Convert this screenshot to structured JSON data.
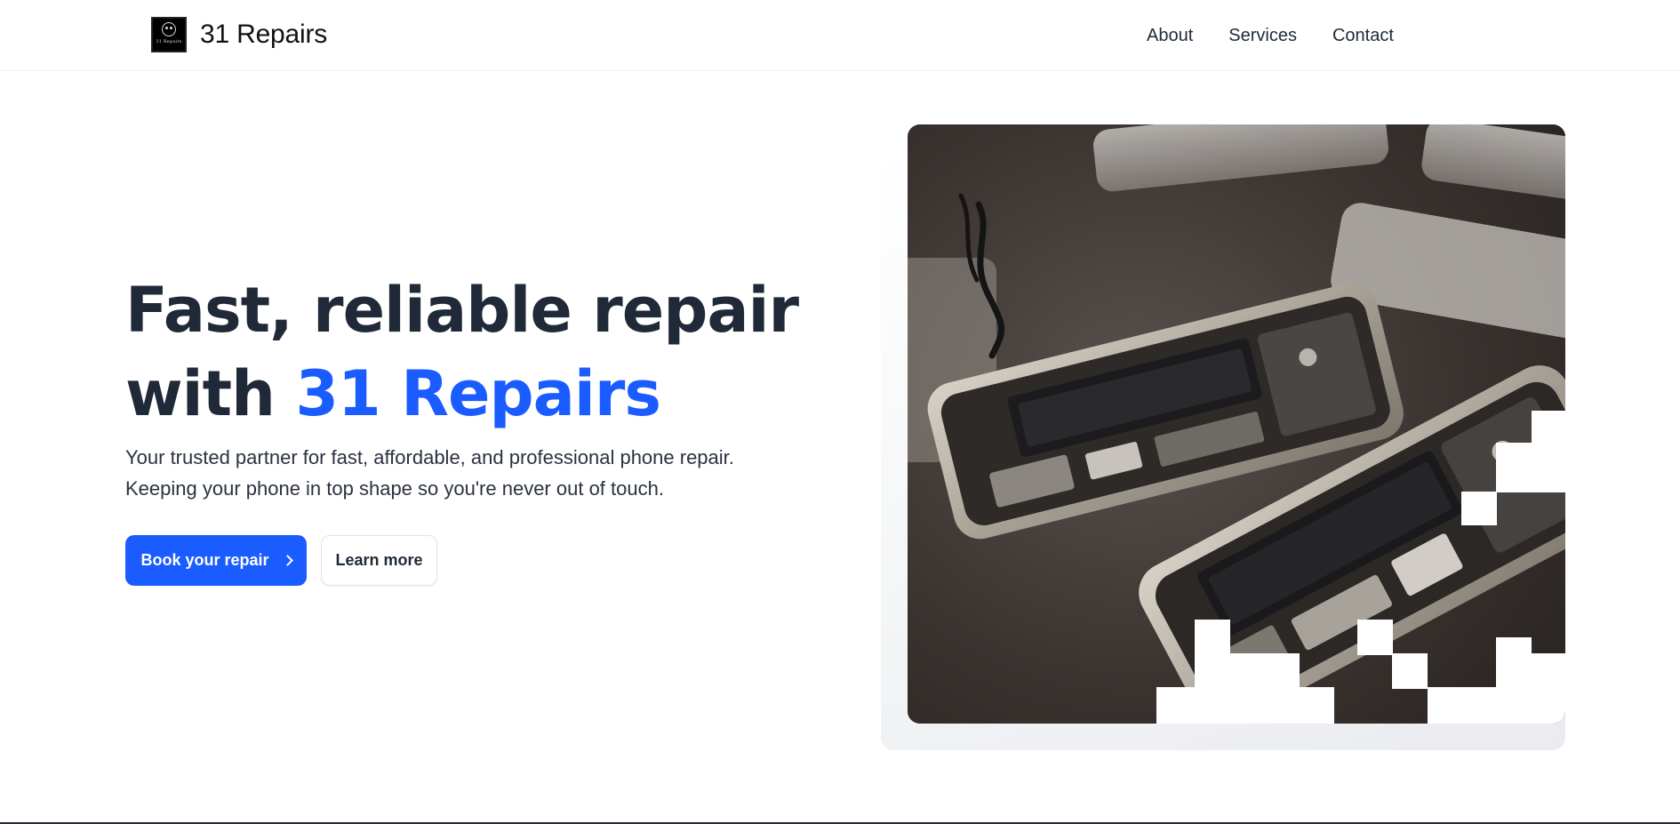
{
  "brand": {
    "name": "31 Repairs",
    "logo_text": "31 Repairs"
  },
  "nav": {
    "items": [
      "About",
      "Services",
      "Contact"
    ]
  },
  "hero": {
    "title_line1": "Fast, reliable repair",
    "title_line2_prefix": "with ",
    "title_line2_accent": "31 Repairs",
    "description": "Your trusted partner for fast, affordable, and professional phone repair. Keeping your phone in top shape so you're never out of touch.",
    "primary_button": "Book your repair",
    "secondary_button": "Learn more"
  },
  "colors": {
    "accent": "#1a5cff",
    "text": "#1f2937"
  },
  "icons": {
    "logo": "smiley-logo-icon",
    "button_arrow": "chevron-right-icon"
  }
}
